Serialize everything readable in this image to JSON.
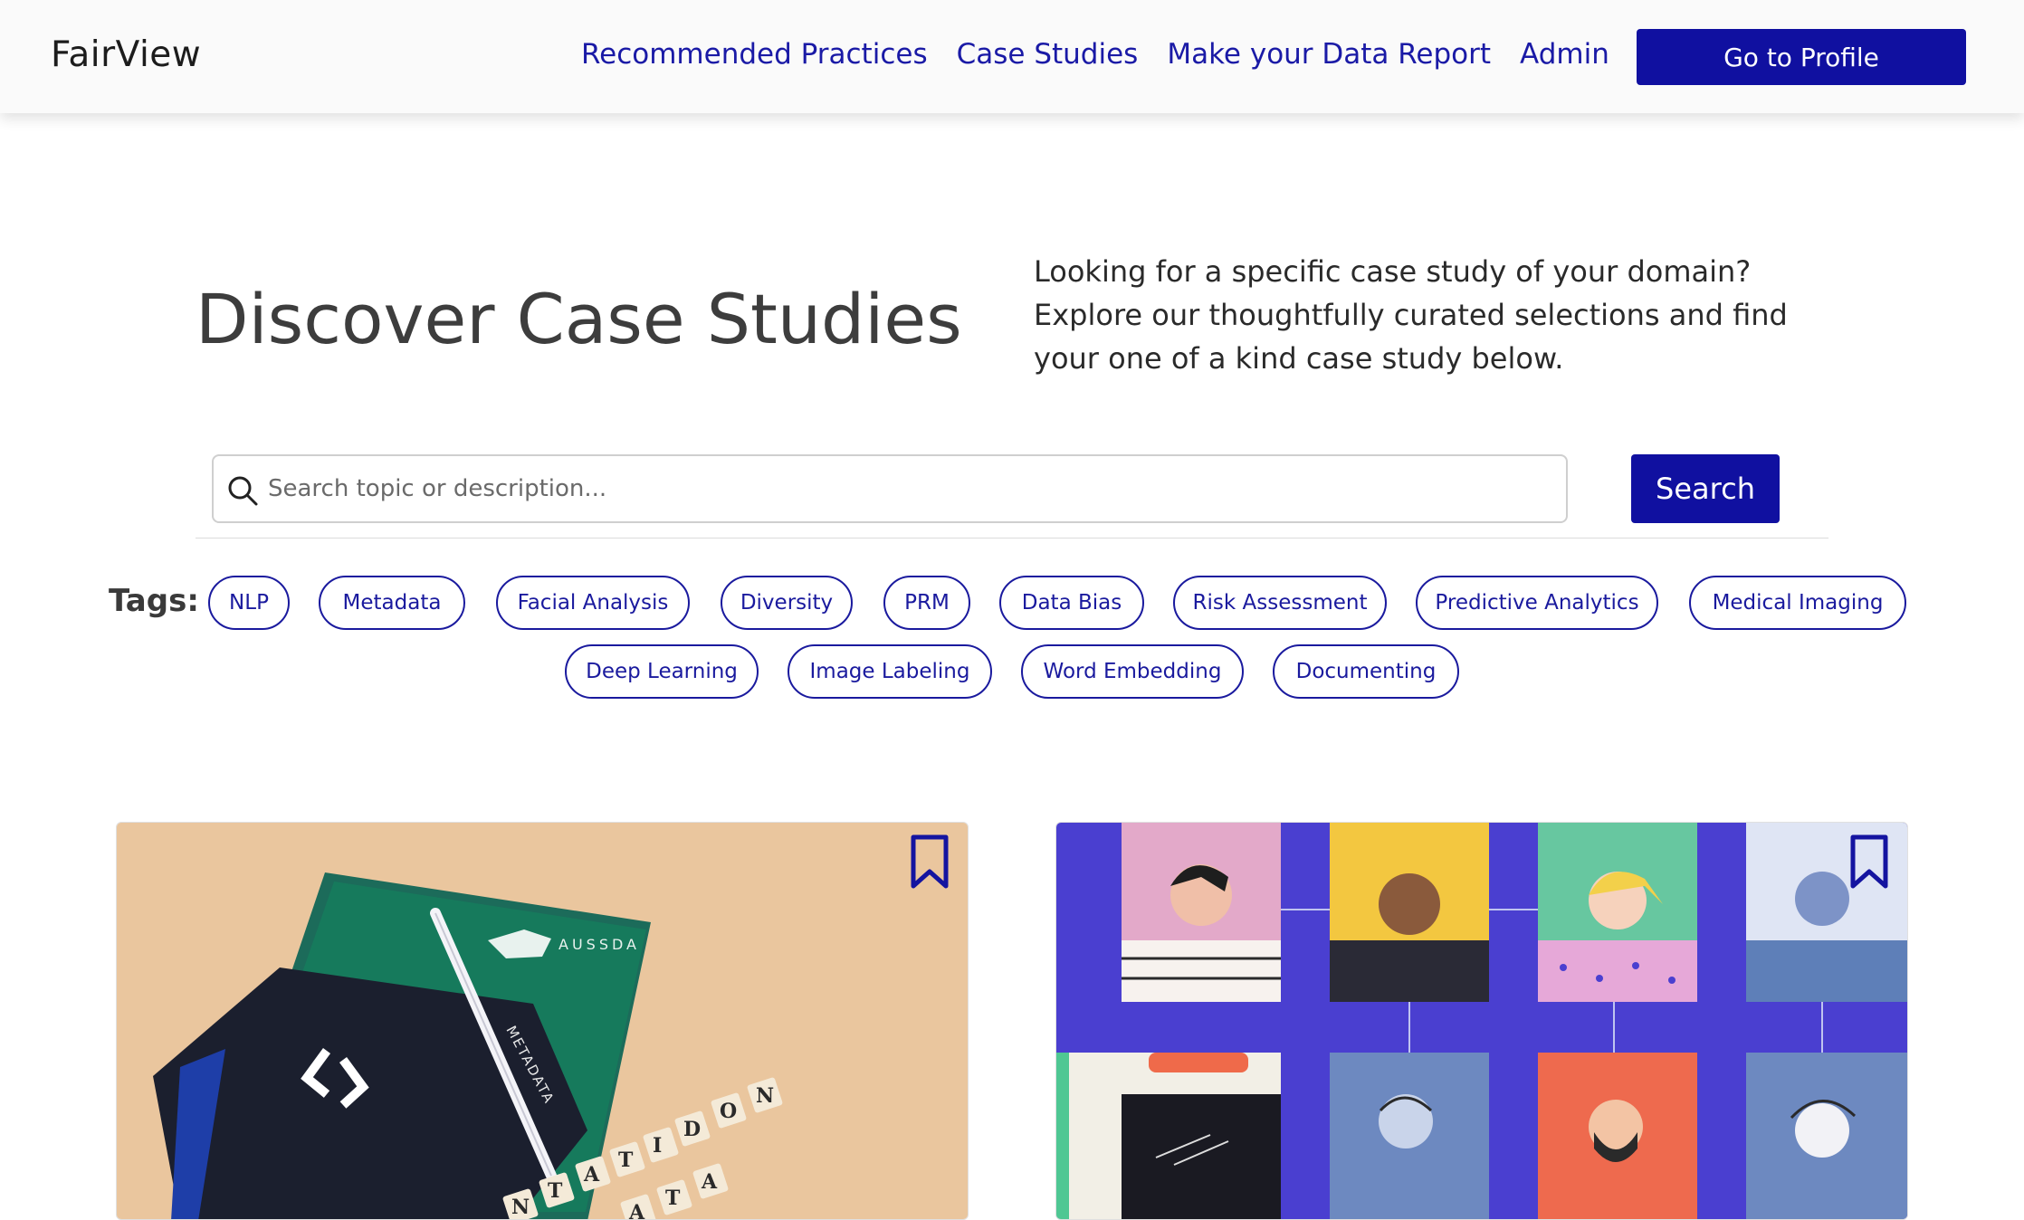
{
  "navbar": {
    "brand": "FairView",
    "links": [
      {
        "label": "Recommended Practices"
      },
      {
        "label": "Case Studies"
      },
      {
        "label": "Make your Data Report"
      },
      {
        "label": "Admin"
      }
    ],
    "profile_button": "Go to Profile"
  },
  "hero": {
    "title": "Discover Case Studies",
    "description": "Looking for a specific case study of your domain? Explore our thoughtfully curated selections and find your one of a kind case study below."
  },
  "search": {
    "icon": "search-icon",
    "placeholder": "Search topic or description...",
    "value": "",
    "button_label": "Search"
  },
  "tags": {
    "label": "Tags:",
    "items": [
      "NLP",
      "Metadata",
      "Facial Analysis",
      "Diversity",
      "PRM",
      "Data Bias",
      "Risk Assessment",
      "Predictive Analytics",
      "Medical Imaging",
      "Deep Learning",
      "Image Labeling",
      "Word Embedding",
      "Documenting"
    ]
  },
  "cards": [
    {
      "image_subject": "metadata booklets and scrabble tiles",
      "image_text": {
        "brand": "AUSSDA",
        "book": "METADATA",
        "tiles_1": "DOCUMENTATION",
        "tiles_2": "DATA"
      },
      "bookmark_icon": "bookmark-icon"
    },
    {
      "image_subject": "grid of illustrated people portraits",
      "bookmark_icon": "bookmark-icon"
    }
  ],
  "colors": {
    "primary": "#1010a0",
    "link": "#1a1aa6",
    "card2_bg": "#4a3fd0"
  }
}
